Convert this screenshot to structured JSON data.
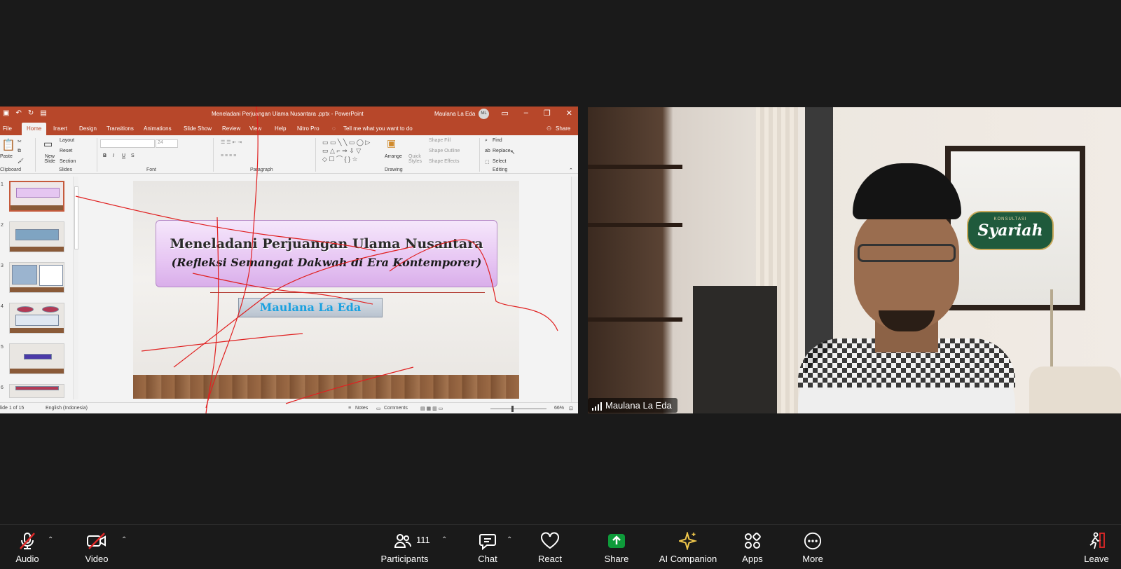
{
  "powerpoint": {
    "doc_title": "Meneladani Perjuangan Ulama Nusantara .pptx  -  PowerPoint",
    "user_name": "Maulana La Eda",
    "user_initials": "ML",
    "tabs": [
      "File",
      "Home",
      "Insert",
      "Design",
      "Transitions",
      "Animations",
      "Slide Show",
      "Review",
      "View",
      "Help",
      "Nitro Pro"
    ],
    "tell_me": "Tell me what you want to do",
    "share_label": "Share",
    "ribbon": {
      "paste": "Paste",
      "new_slide": "New Slide",
      "layout": "Layout",
      "reset": "Reset",
      "section": "Section",
      "font_size": "24",
      "arrange": "Arrange",
      "quick_styles": "Quick Styles",
      "shape_fill": "Shape Fill",
      "shape_outline": "Shape Outline",
      "shape_effects": "Shape Effects",
      "find": "Find",
      "replace": "Replace",
      "select": "Select",
      "groups": [
        "Clipboard",
        "Slides",
        "Font",
        "Paragraph",
        "Drawing",
        "Editing"
      ]
    },
    "thumb_numbers": [
      "1",
      "2",
      "3",
      "4",
      "5",
      "6"
    ],
    "slide": {
      "title": "Meneladani Perjuangan Ulama Nusantara",
      "subtitle": "(Refleksi Semangat Dakwah di Era Kontemporer)",
      "presenter": "Maulana La Eda"
    },
    "status": {
      "slide_count": "lide 1 of 15",
      "language": "English (Indonesia)",
      "notes": "Notes",
      "comments": "Comments",
      "zoom": "66%"
    }
  },
  "video": {
    "participant_name": "Maulana La Eda",
    "background_badge_top": "KONSULTASI",
    "background_badge_main": "Syariah"
  },
  "toolbar": {
    "audio": "Audio",
    "video": "Video",
    "participants": "Participants",
    "participant_count": "111",
    "chat": "Chat",
    "react": "React",
    "share": "Share",
    "ai_companion": "AI Companion",
    "apps": "Apps",
    "more": "More",
    "leave": "Leave"
  },
  "colors": {
    "ppt_accent": "#b7472a",
    "share_green": "#0e9b3a",
    "ai_gold": "#f2c94c",
    "annotation_red": "#e02020",
    "muted_red": "#e02828"
  }
}
